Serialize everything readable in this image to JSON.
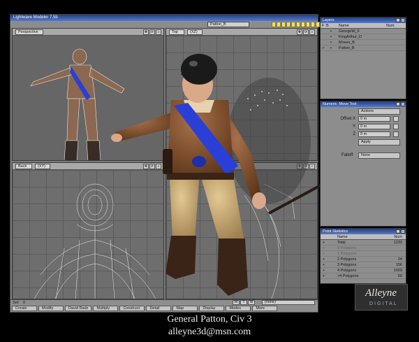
{
  "window_title": "Lightwave Modeler 7.5b",
  "object_selector": "Patton_B",
  "viewports": {
    "top_left": {
      "view": "Perspective"
    },
    "top_right": {
      "view": "Top",
      "mode": "(XZ)"
    },
    "bottom_left": {
      "view": "Back",
      "mode": "(XY)"
    }
  },
  "status": {
    "label": "Sel:",
    "value": "0"
  },
  "wtm_buttons": [
    "W",
    "T",
    "M"
  ],
  "none_select": "(none)",
  "menu_buttons": [
    "Create",
    "Modify",
    "David Radz",
    "Multiply",
    "Construct",
    "Detail",
    "Map",
    "Display",
    "Modes",
    "More"
  ],
  "layers_panel": {
    "title": "Layers",
    "headers": {
      "flags": "F",
      "bg": "B",
      "name": "Name",
      "num": "Num"
    },
    "items": [
      {
        "name": "GeorgeW_F",
        "checked": false
      },
      {
        "name": "KingArthur_D",
        "checked": false
      },
      {
        "name": "Moses_B",
        "checked": false
      },
      {
        "name": "Patton_B",
        "checked": true
      }
    ]
  },
  "numeric_panel": {
    "title": "Numeric: Move Tool",
    "actions_label": "Actions",
    "offset_label": "Offset X",
    "y_label": "Y",
    "z_label": "Z",
    "x_value": "0 m",
    "y_value": "0 m",
    "z_value": "0 m",
    "apply_label": "Apply",
    "falloff_label": "Falloff",
    "falloff_value": "None"
  },
  "point_stats": {
    "title": "Point Statistics",
    "headers": {
      "name": "Name",
      "num": "Num"
    },
    "rows": [
      {
        "name": "Total",
        "num": "1233",
        "dim": false
      },
      {
        "name": "0 Polygons",
        "num": "",
        "dim": true
      },
      {
        "name": "1 Polygons",
        "num": "",
        "dim": true
      },
      {
        "name": "2 Polygons",
        "num": "24",
        "dim": false
      },
      {
        "name": "3 Polygons",
        "num": "156",
        "dim": false
      },
      {
        "name": "4 Polygons",
        "num": "1003",
        "dim": false
      },
      {
        "name": ">4 Polygons",
        "num": "50",
        "dim": false
      }
    ]
  },
  "logo": {
    "line1": "Alleyne",
    "line2": "DIGITAL"
  },
  "caption": {
    "title": "General Patton, Civ 3",
    "email": "alleyne3d@msn.com"
  },
  "colors": {
    "sash": "#2a3fd6",
    "jacket": "#7a4a2a",
    "pants": "#c9a96e",
    "boots": "#3a2418",
    "helmet": "#151515",
    "skin": "#d9a98a"
  }
}
